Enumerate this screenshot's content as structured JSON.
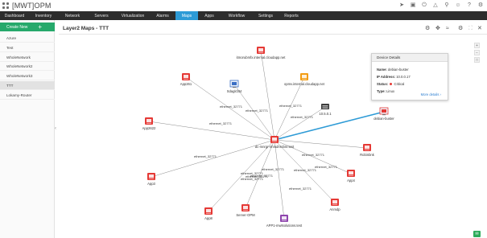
{
  "app": {
    "title": "[MWT]OPM",
    "top_icons": [
      "rocket-icon",
      "monitor-icon",
      "power-icon",
      "bell-icon",
      "search-icon",
      "user-icon",
      "help-icon",
      "settings-icon"
    ]
  },
  "nav": {
    "items": [
      "Dashboard",
      "Inventory",
      "Network",
      "Servers",
      "Virtualization",
      "Alarms",
      "Maps",
      "Apps",
      "Workflow",
      "Settings",
      "Reports"
    ],
    "active": "Maps"
  },
  "sidebar": {
    "create_label": "Create New",
    "items": [
      "Azure",
      "Test",
      "WholeNetwork",
      "WholeNetwork2",
      "WholeNetwork3",
      "TTT",
      "Lokamy-Router"
    ],
    "active": "TTT"
  },
  "page": {
    "title": "Layer2 Maps - TTT"
  },
  "colors": {
    "nav_active": "#2e9bd6",
    "nav_bg": "#2d2d2d",
    "create_btn": "#26a96b",
    "device_critical": "#e53935",
    "highlight_link": "#2e9bd6"
  },
  "map": {
    "center": {
      "id": "center",
      "label": "dc-mnrgr-nhmdnrobnr.test",
      "icon": "router-icon",
      "status": "critical"
    },
    "nodes": [
      {
        "id": "n1",
        "label": "itmorubmfx.internal.cloudapp.net",
        "icon": "server-icon",
        "status": "critical"
      },
      {
        "id": "n2",
        "label": "opmv.internal.cloudapp.net",
        "icon": "server-icon",
        "status": "warning"
      },
      {
        "id": "n3",
        "label": "App261",
        "icon": "server-icon",
        "status": "critical"
      },
      {
        "id": "n4",
        "label": "Sdaglcbt4",
        "icon": "monitor-icon",
        "status": "info"
      },
      {
        "id": "n5",
        "label": "10.5.0.1",
        "icon": "switch-icon",
        "status": "unknown"
      },
      {
        "id": "n6",
        "label": "debian-buster",
        "icon": "monitor-icon",
        "status": "critical"
      },
      {
        "id": "n7",
        "label": "App2622",
        "icon": "server-icon",
        "status": "critical"
      },
      {
        "id": "n8",
        "label": "Robinbnk",
        "icon": "server-icon",
        "status": "critical"
      },
      {
        "id": "n9",
        "label": "App3",
        "icon": "server-icon",
        "status": "critical"
      },
      {
        "id": "n10",
        "label": "App4",
        "icon": "server-icon",
        "status": "critical"
      },
      {
        "id": "n11",
        "label": "App8",
        "icon": "server-icon",
        "status": "critical"
      },
      {
        "id": "n12",
        "label": "Server-OPM",
        "icon": "server-icon",
        "status": "critical"
      },
      {
        "id": "n13",
        "label": "APP1-mwtsolutions.test",
        "icon": "server-icon",
        "status": "purple"
      },
      {
        "id": "n14",
        "label": "Anmdp",
        "icon": "server-icon",
        "status": "critical"
      }
    ],
    "links": [
      {
        "to": "n1",
        "label": ""
      },
      {
        "to": "n2",
        "label": "ethernet_32771"
      },
      {
        "to": "n3",
        "label": "ethernet_32771"
      },
      {
        "to": "n4",
        "label": "ethernet_32771"
      },
      {
        "to": "n5",
        "label": "ethernet_32771"
      },
      {
        "to": "n6",
        "label": "",
        "highlighted": true
      },
      {
        "to": "n7",
        "label": ""
      },
      {
        "to": "n8",
        "label": "ethernet_32771"
      },
      {
        "to": "n9",
        "label": "ethernet_32771"
      },
      {
        "to": "n10",
        "label": "ethernet_32771"
      },
      {
        "to": "n11",
        "label": "ethernet_32771"
      },
      {
        "to": "n12",
        "label": "ethernet_32771"
      },
      {
        "to": "n13",
        "label": "ethernet_32771"
      },
      {
        "to": "n14",
        "label": "ethernet_32771"
      }
    ],
    "extra_link_labels": [
      "ethernet_32771",
      "ethernet_32771",
      "ethernet_32771",
      "ethernet_32771"
    ]
  },
  "popup": {
    "title": "Device Details",
    "name_label": "Name:",
    "name": "debian-buster",
    "ip_label": "IP Address:",
    "ip": "10.0.0.17",
    "status_label": "Status:",
    "status": "Critical",
    "type_label": "Type:",
    "type": "Linux",
    "more": "More details"
  }
}
